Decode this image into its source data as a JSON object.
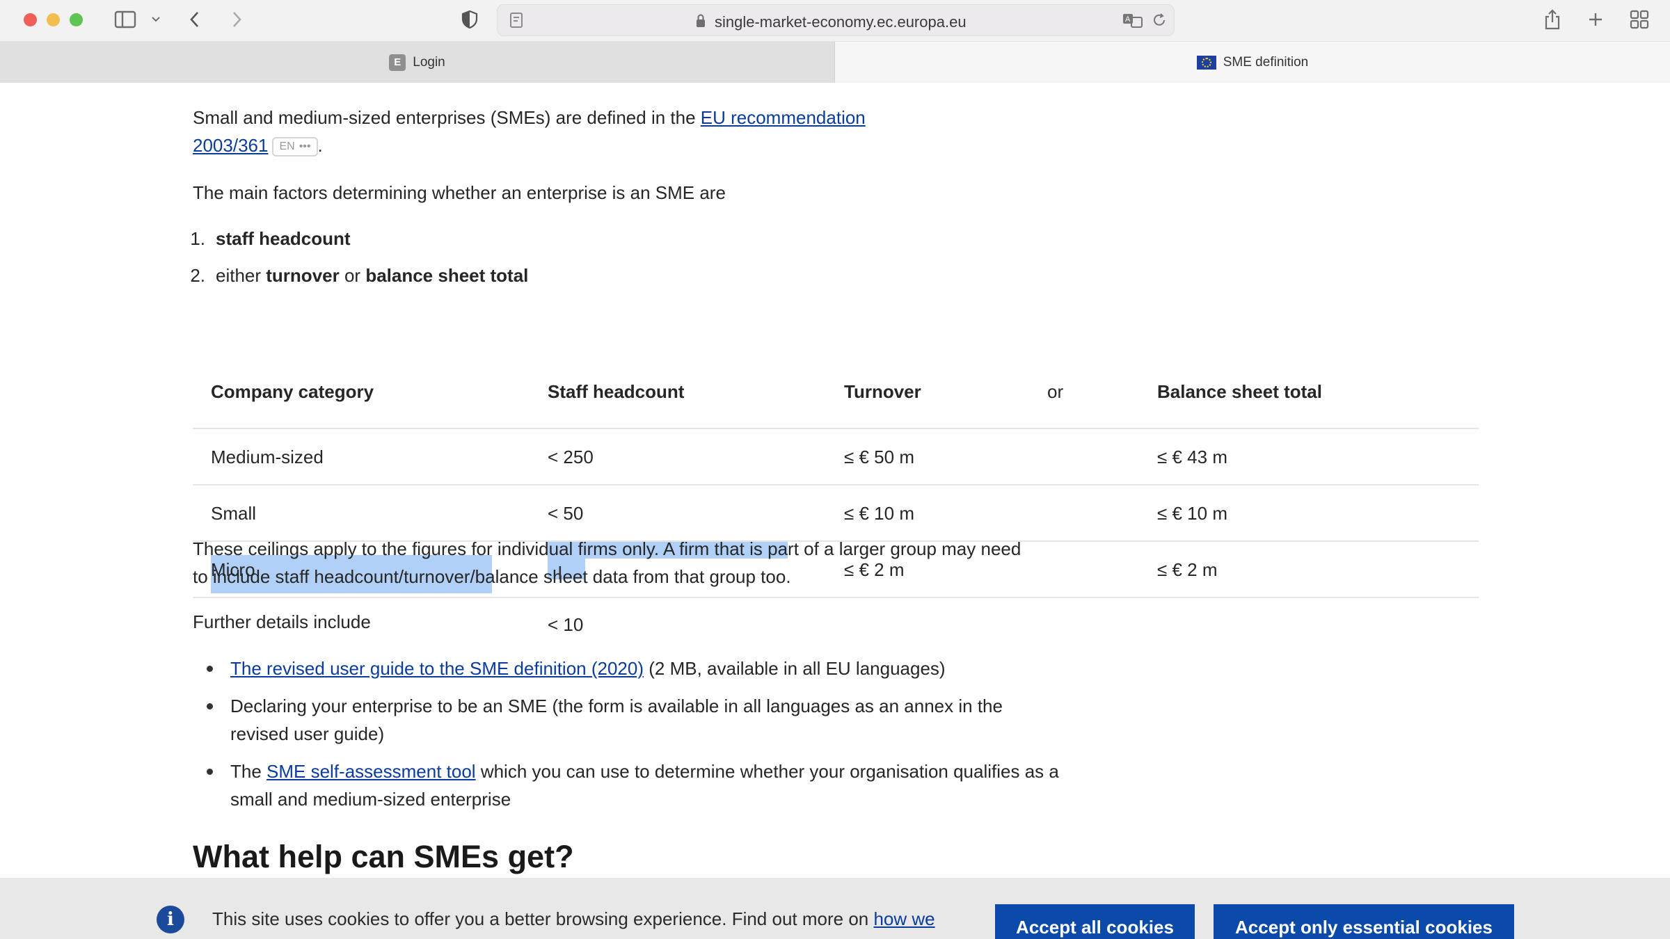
{
  "browser": {
    "url": "single-market-economy.ec.europa.eu",
    "tabs": [
      {
        "label": "Login",
        "favicon": "E",
        "active": false
      },
      {
        "label": "SME definition",
        "favicon": "eu-flag-icon",
        "active": true
      }
    ]
  },
  "page": {
    "intro_text": "Small and medium-sized enterprises (SMEs) are defined in the ",
    "intro_link": "EU recommendation 2003/361",
    "lang_badge": "EN",
    "lang_more": "•••",
    "intro_end": ".",
    "factors_intro": "The main factors determining whether an enterprise is an SME are",
    "factors": [
      {
        "num": "1.",
        "pre": "",
        "bold1": "staff headcount",
        "mid": "",
        "bold2": ""
      },
      {
        "num": "2.",
        "pre": "either ",
        "bold1": "turnover",
        "mid": " or ",
        "bold2": "balance sheet total"
      }
    ],
    "table": {
      "headers": [
        "Company category",
        "Staff headcount",
        "Turnover",
        "or",
        "Balance sheet total"
      ],
      "rows": [
        [
          "Medium-sized",
          "< 250",
          "≤ € 50 m",
          "≤ € 43 m"
        ],
        [
          "Small",
          "< 50",
          "≤ € 10 m",
          "≤ € 10 m"
        ],
        [
          "Micro",
          "< 10",
          "≤ € 2 m",
          "≤ € 2 m"
        ]
      ]
    },
    "ceilings_text": "These ceilings apply to the figures for individual firms only. A firm that is part of a larger group may need to include staff headcount/turnover/balance sheet data from that group too.",
    "further_intro": "Further details include",
    "bullets": [
      {
        "link": "The revised user guide to the SME definition (2020)",
        "text": " (2 MB, available in all EU languages)"
      },
      {
        "pre": "Declaring your enterprise to be an SME (the form is available in all languages as an annex in the revised user guide)"
      },
      {
        "pre": "The ",
        "link": "SME self-assessment tool",
        "text": " which you can use to determine whether your organisation qualifies as a small and medium-sized enterprise"
      }
    ],
    "heading": "What help can SMEs get?"
  },
  "cookie": {
    "text": "This site uses cookies to offer you a better browsing experience. Find out more on ",
    "link": "how we",
    "accept_all": "Accept all cookies",
    "accept_essential": "Accept only essential cookies"
  },
  "colors": {
    "link": "#0a3c9c",
    "selection": "#b1d0f8",
    "button": "#0b4aa8"
  }
}
